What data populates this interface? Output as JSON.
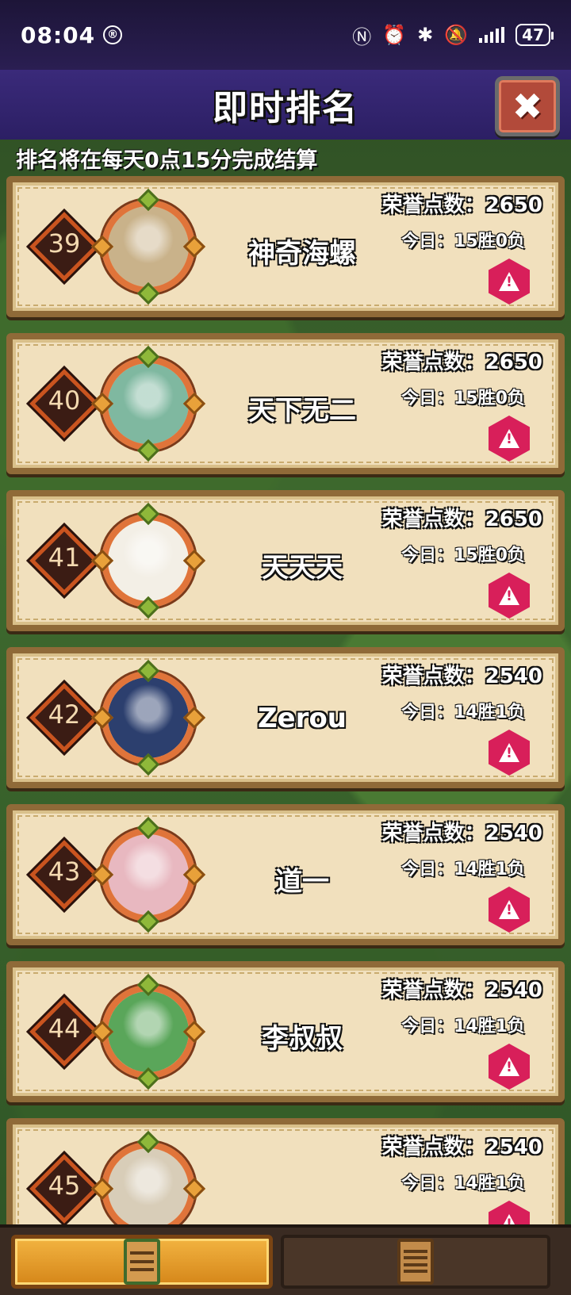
{
  "status_bar": {
    "time": "08:04",
    "battery": "47",
    "indicator_glyph": "®"
  },
  "header": {
    "title": "即时排名",
    "close_icon": "✖"
  },
  "notice": "排名将在每天0点15分完成结算",
  "entries": [
    {
      "rank": "39",
      "name": "神奇海螺",
      "honor": "荣誉点数：2650",
      "today": "今日：15胜0负",
      "avatar": "bee-avatar",
      "avatar_color": "#c9b28a"
    },
    {
      "rank": "40",
      "name": "天下无二",
      "honor": "荣誉点数：2650",
      "today": "今日：15胜0负",
      "avatar": "warrior-avatar",
      "avatar_color": "#7fb8a0"
    },
    {
      "rank": "41",
      "name": "天天天",
      "honor": "荣誉点数：2650",
      "today": "今日：15胜0负",
      "avatar": "monkey-avatar",
      "avatar_color": "#f3efe6"
    },
    {
      "rank": "42",
      "name": "Zerou",
      "honor": "荣誉点数：2540",
      "today": "今日：14胜1负",
      "avatar": "suit-man-avatar",
      "avatar_color": "#2c3f6e"
    },
    {
      "rank": "43",
      "name": "道一",
      "honor": "荣誉点数：2540",
      "today": "今日：14胜1负",
      "avatar": "cat-avatar",
      "avatar_color": "#e8b8c0"
    },
    {
      "rank": "44",
      "name": "李叔叔",
      "honor": "荣誉点数：2540",
      "today": "今日：14胜1负",
      "avatar": "dragon-rider-avatar",
      "avatar_color": "#5aa65a"
    },
    {
      "rank": "45",
      "name": "",
      "honor": "荣誉点数：2540",
      "today": "今日：14胜1负",
      "avatar": "partial-avatar",
      "avatar_color": "#d8cdb8"
    }
  ],
  "report_icon": "!",
  "bottom_tabs": [
    {
      "name": "ranking-tab",
      "icon": "list-scroll-icon",
      "active": true
    },
    {
      "name": "records-tab",
      "icon": "scroll-icon",
      "active": false
    }
  ]
}
